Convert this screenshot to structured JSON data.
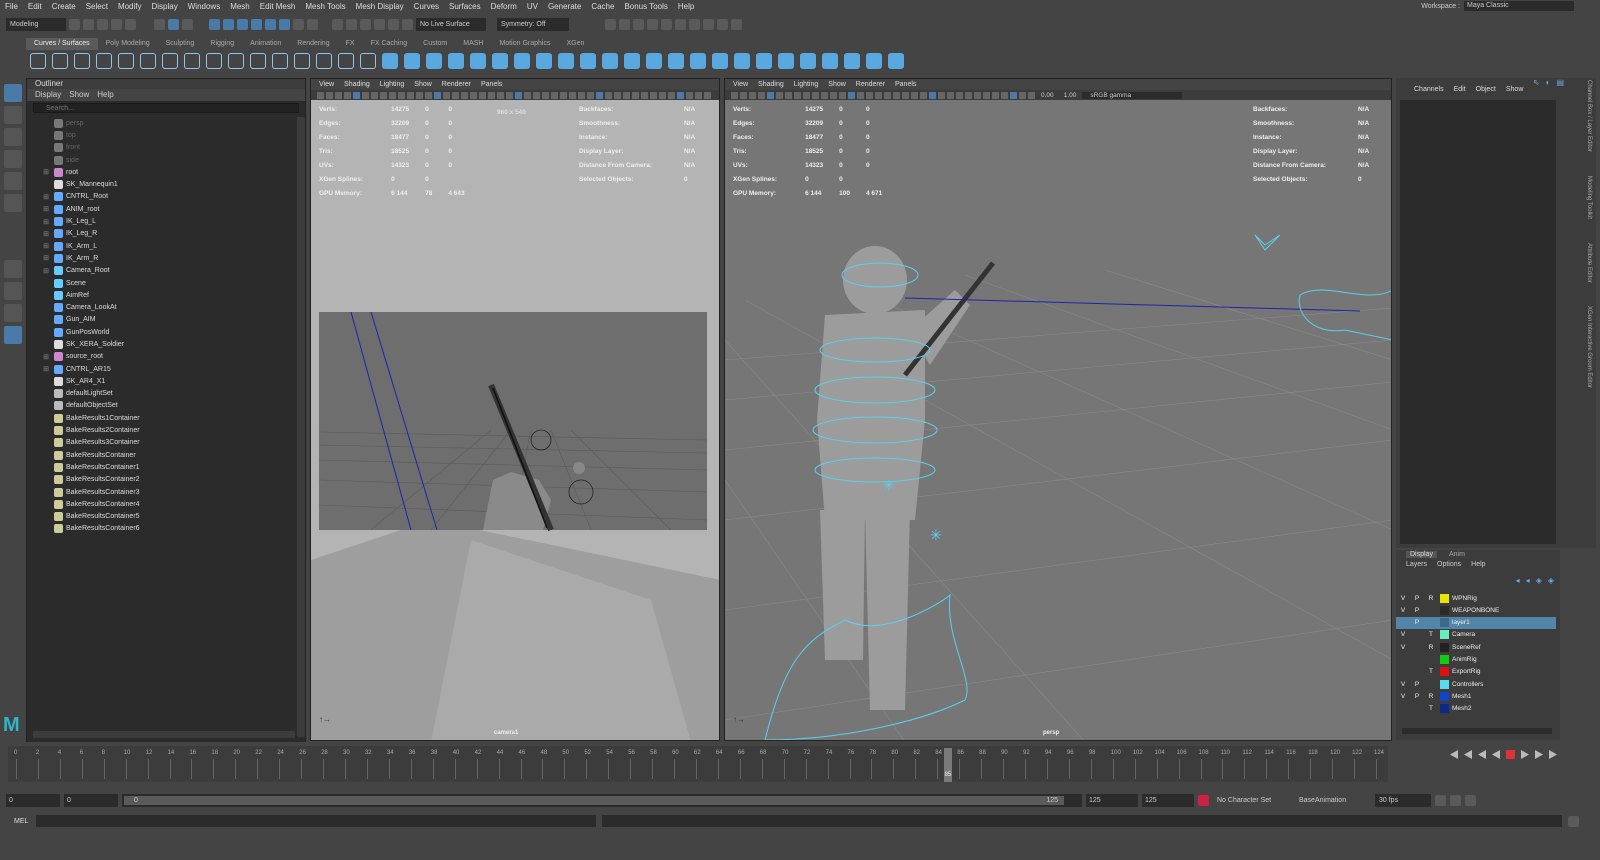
{
  "menubar": [
    "File",
    "Edit",
    "Create",
    "Select",
    "Modify",
    "Display",
    "Windows",
    "Mesh",
    "Edit Mesh",
    "Mesh Tools",
    "Mesh Display",
    "Curves",
    "Surfaces",
    "Deform",
    "UV",
    "Generate",
    "Cache",
    "Bonus Tools",
    "Help"
  ],
  "workspace": {
    "label": "Workspace :",
    "value": "Maya Classic"
  },
  "status": {
    "mode": "Modeling",
    "live_surface": "No Live Surface",
    "symmetry": "Symmetry: Off"
  },
  "shelf_tabs": [
    "Curves / Surfaces",
    "Poly Modeling",
    "Sculpting",
    "Rigging",
    "Animation",
    "Rendering",
    "FX",
    "FX Caching",
    "Custom",
    "MASH",
    "Motion Graphics",
    "XGen"
  ],
  "shelf_active": 0,
  "outliner": {
    "title": "Outliner",
    "menu": [
      "Display",
      "Show",
      "Help"
    ],
    "search_placeholder": "Search...",
    "items": [
      {
        "name": "persp",
        "dim": true,
        "exp": false,
        "icon": "camera-icon"
      },
      {
        "name": "top",
        "dim": true,
        "exp": false,
        "icon": "camera-icon"
      },
      {
        "name": "front",
        "dim": true,
        "exp": false,
        "icon": "camera-icon"
      },
      {
        "name": "side",
        "dim": true,
        "exp": false,
        "icon": "camera-icon"
      },
      {
        "name": "root",
        "exp": true,
        "icon": "joint-icon"
      },
      {
        "name": "SK_Mannequin1",
        "exp": false,
        "icon": "mesh-icon"
      },
      {
        "name": "CNTRL_Root",
        "exp": true,
        "icon": "curve-icon"
      },
      {
        "name": "ANIM_root",
        "exp": true,
        "icon": "curve-icon"
      },
      {
        "name": "IK_Leg_L",
        "exp": true,
        "icon": "curve-icon"
      },
      {
        "name": "IK_Leg_R",
        "exp": true,
        "icon": "curve-icon"
      },
      {
        "name": "IK_Arm_L",
        "exp": true,
        "icon": "curve-icon"
      },
      {
        "name": "IK_Arm_R",
        "exp": true,
        "icon": "curve-icon"
      },
      {
        "name": "Camera_Root",
        "exp": true,
        "icon": "locator-icon"
      },
      {
        "name": "Scene",
        "exp": false,
        "icon": "locator-icon"
      },
      {
        "name": "AimRef",
        "exp": false,
        "icon": "locator-icon"
      },
      {
        "name": "Camera_LookAt",
        "exp": false,
        "icon": "curve-icon"
      },
      {
        "name": "Gun_AIM",
        "exp": false,
        "icon": "curve-icon"
      },
      {
        "name": "GunPosWorld",
        "exp": false,
        "icon": "curve-icon"
      },
      {
        "name": "SK_XERA_Soldier",
        "exp": false,
        "icon": "mesh-icon"
      },
      {
        "name": "source_root",
        "exp": true,
        "icon": "joint-icon"
      },
      {
        "name": "CNTRL_AR15",
        "exp": true,
        "icon": "curve-icon"
      },
      {
        "name": "SK_AR4_X1",
        "exp": false,
        "icon": "mesh-icon"
      },
      {
        "name": "defaultLightSet",
        "exp": false,
        "icon": "set-icon"
      },
      {
        "name": "defaultObjectSet",
        "exp": false,
        "icon": "set-icon"
      },
      {
        "name": "BakeResults1Container",
        "exp": false,
        "icon": "container-icon"
      },
      {
        "name": "BakeResults2Container",
        "exp": false,
        "icon": "container-icon"
      },
      {
        "name": "BakeResults3Container",
        "exp": false,
        "icon": "container-icon"
      },
      {
        "name": "BakeResultsContainer",
        "exp": false,
        "icon": "container-icon"
      },
      {
        "name": "BakeResultsContainer1",
        "exp": false,
        "icon": "container-icon"
      },
      {
        "name": "BakeResultsContainer2",
        "exp": false,
        "icon": "container-icon"
      },
      {
        "name": "BakeResultsContainer3",
        "exp": false,
        "icon": "container-icon"
      },
      {
        "name": "BakeResultsContainer4",
        "exp": false,
        "icon": "container-icon"
      },
      {
        "name": "BakeResultsContainer5",
        "exp": false,
        "icon": "container-icon"
      },
      {
        "name": "BakeResultsContainer6",
        "exp": false,
        "icon": "container-icon"
      }
    ]
  },
  "viewport_menu": [
    "View",
    "Shading",
    "Lighting",
    "Show",
    "Renderer",
    "Panels"
  ],
  "vp1": {
    "resolution": "960 x 540",
    "camera": "camera1",
    "hud_left": [
      [
        "Verts:",
        "14275",
        "0",
        "0"
      ],
      [
        "Edges:",
        "32209",
        "0",
        "0"
      ],
      [
        "Faces:",
        "18477",
        "0",
        "0"
      ],
      [
        "Tris:",
        "18525",
        "0",
        "0"
      ],
      [
        "UVs:",
        "14323",
        "0",
        "0"
      ],
      [
        "XGen Splines:",
        "0",
        "0"
      ],
      [
        "GPU Memory:",
        "6 144",
        "78",
        "4 643"
      ]
    ],
    "hud_right": [
      [
        "Backfaces:",
        "N/A"
      ],
      [
        "Smoothness:",
        "N/A"
      ],
      [
        "Instance:",
        "N/A"
      ],
      [
        "Display Layer:",
        "N/A"
      ],
      [
        "Distance From Camera:",
        "N/A"
      ],
      [
        "Selected Objects:",
        "0"
      ]
    ]
  },
  "vp2": {
    "camera": "persp",
    "exposure": "0.00",
    "gamma": "1.00",
    "colorspace": "sRGB gamma",
    "hud_left": [
      [
        "Verts:",
        "14275",
        "0",
        "0"
      ],
      [
        "Edges:",
        "32209",
        "0",
        "0"
      ],
      [
        "Faces:",
        "18477",
        "0",
        "0"
      ],
      [
        "Tris:",
        "18525",
        "0",
        "0"
      ],
      [
        "UVs:",
        "14323",
        "0",
        "0"
      ],
      [
        "XGen Splines:",
        "0",
        "0"
      ],
      [
        "GPU Memory:",
        "6 144",
        "100",
        "4 671"
      ]
    ],
    "hud_right": [
      [
        "Backfaces:",
        "N/A"
      ],
      [
        "Smoothness:",
        "N/A"
      ],
      [
        "Instance:",
        "N/A"
      ],
      [
        "Display Layer:",
        "N/A"
      ],
      [
        "Distance From Camera:",
        "N/A"
      ],
      [
        "Selected Objects:",
        "0"
      ]
    ]
  },
  "channel_box": {
    "menu": [
      "Channels",
      "Edit",
      "Object",
      "Show"
    ]
  },
  "side_tabs": [
    "Channel Box / Layer Editor",
    "Modeling Toolkit",
    "Attribute Editor",
    "XGen Interactive Groom Editor"
  ],
  "layers": {
    "tabs": [
      "Display",
      "Anim"
    ],
    "menu": [
      "Layers",
      "Options",
      "Help"
    ],
    "rows": [
      {
        "v": "V",
        "p": "P",
        "r": "R",
        "name": "WPNRig",
        "color": "#e6e600",
        "sel": false
      },
      {
        "v": "V",
        "p": "P",
        "r": "",
        "name": "WEAPONBONE",
        "color": "#2b2b2b",
        "sel": false
      },
      {
        "v": "",
        "p": "P",
        "r": "",
        "name": "layer1",
        "color": "#3a6a8a",
        "sel": true
      },
      {
        "v": "V",
        "p": "",
        "r": "T",
        "name": "Camera",
        "color": "#66eebb",
        "sel": false
      },
      {
        "v": "V",
        "p": "",
        "r": "R",
        "name": "SceneRef",
        "color": "#222222",
        "sel": false
      },
      {
        "v": "",
        "p": "",
        "r": "",
        "name": "AnimRig",
        "color": "#11cc11",
        "sel": false
      },
      {
        "v": "",
        "p": "",
        "r": "T",
        "name": "ExportRig",
        "color": "#dd1111",
        "sel": false
      },
      {
        "v": "V",
        "p": "P",
        "r": "",
        "name": "Controllers",
        "color": "#55ddee",
        "sel": false
      },
      {
        "v": "V",
        "p": "P",
        "r": "R",
        "name": "Mesh1",
        "color": "#1144cc",
        "sel": false
      },
      {
        "v": "",
        "p": "",
        "r": "T",
        "name": "Mesh2",
        "color": "#0a2a88",
        "sel": false
      }
    ]
  },
  "timeline": {
    "ticks": [
      "0",
      "2",
      "4",
      "6",
      "8",
      "10",
      "12",
      "14",
      "16",
      "18",
      "20",
      "22",
      "24",
      "26",
      "28",
      "30",
      "32",
      "34",
      "36",
      "38",
      "40",
      "42",
      "44",
      "46",
      "48",
      "50",
      "52",
      "54",
      "56",
      "58",
      "60",
      "62",
      "64",
      "66",
      "68",
      "70",
      "72",
      "74",
      "76",
      "78",
      "80",
      "82",
      "84",
      "86",
      "88",
      "90",
      "92",
      "94",
      "96",
      "98",
      "100",
      "102",
      "104",
      "106",
      "108",
      "110",
      "112",
      "114",
      "116",
      "118",
      "120",
      "122",
      "124"
    ],
    "current": "85",
    "current_frac": 0.685
  },
  "range": {
    "start": "0",
    "start2": "0",
    "slider_start": "0",
    "slider_end": "125",
    "end": "125",
    "end2": "125",
    "char_set": "No Character Set",
    "anim_layer": "BaseAnimation",
    "fps": "30 fps"
  },
  "cmd": {
    "label": "MEL"
  },
  "colors": {
    "accent": "#5285a6",
    "curve": "#5ad0ee",
    "aim": "#2222aa"
  }
}
